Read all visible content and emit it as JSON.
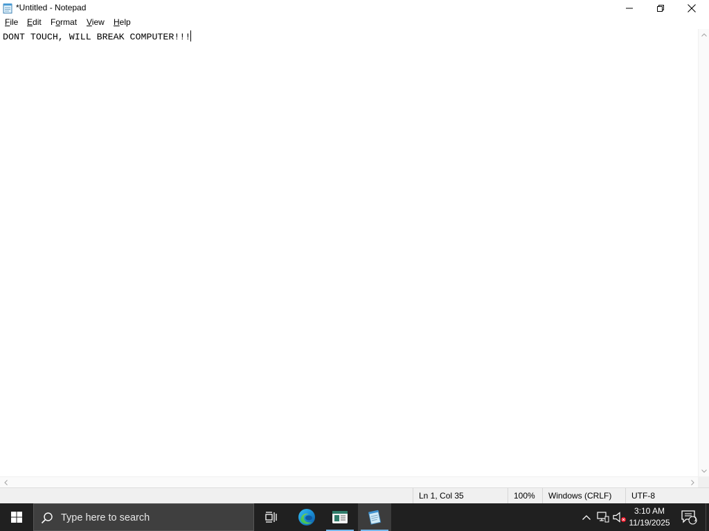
{
  "window": {
    "title": "*Untitled - Notepad"
  },
  "menu": {
    "items": [
      {
        "accel": "F",
        "rest": "ile"
      },
      {
        "accel": "E",
        "rest": "dit"
      },
      {
        "pre": "F",
        "accel": "o",
        "rest": "rmat"
      },
      {
        "accel": "V",
        "rest": "iew"
      },
      {
        "accel": "H",
        "rest": "elp"
      }
    ]
  },
  "editor": {
    "text": "DONT TOUCH, WILL BREAK COMPUTER!!!"
  },
  "status": {
    "position": "Ln 1, Col 35",
    "zoom": "100%",
    "line_ending": "Windows (CRLF)",
    "encoding": "UTF-8"
  },
  "taskbar": {
    "search_placeholder": "Type here to search",
    "apps": [
      "task-view",
      "edge",
      "news",
      "notepad"
    ],
    "active_app": "notepad"
  },
  "tray": {
    "time": "3:10 AM",
    "date": "11/19/2025",
    "notification_count": "1"
  },
  "icons": {
    "app": "notepad-icon",
    "minimize": "minimize-icon",
    "maximize": "restore-icon",
    "close": "close-icon",
    "start": "windows-logo-icon",
    "search": "search-icon"
  },
  "colors": {
    "taskbar_bg": "#202020",
    "accent": "#76b9ed",
    "search_bg": "#3f3f3f"
  }
}
